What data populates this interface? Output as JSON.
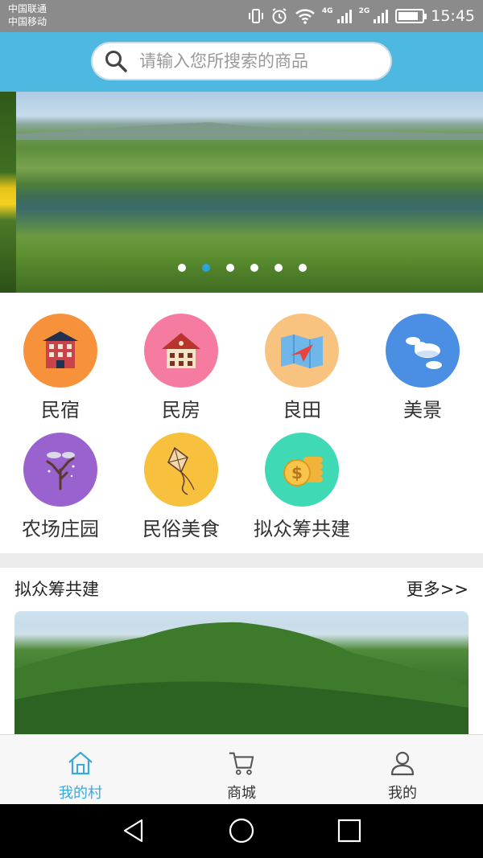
{
  "status_bar": {
    "carrier_1": "中国联通",
    "carrier_2": "中国移动",
    "net_1": "4G",
    "net_2": "2G",
    "time": "15:45",
    "battery_level": 0.85
  },
  "search": {
    "placeholder": "请输入您所搜索的商品"
  },
  "banner": {
    "dot_count": 6,
    "active_dot": 1
  },
  "categories": [
    {
      "label": "民宿",
      "icon": "hotel-building-icon",
      "color": "#f7923a"
    },
    {
      "label": "民房",
      "icon": "house-icon",
      "color": "#f57ca0"
    },
    {
      "label": "良田",
      "icon": "map-icon",
      "color": "#f8c27f"
    },
    {
      "label": "美景",
      "icon": "clouds-icon",
      "color": "#4a8fe4"
    },
    {
      "label": "农场庄园",
      "icon": "tree-icon",
      "color": "#9a62cf"
    },
    {
      "label": "民俗美食",
      "icon": "kite-icon",
      "color": "#f7c13e"
    },
    {
      "label": "拟众筹共建",
      "icon": "coins-icon",
      "color": "#3fd9b6"
    }
  ],
  "section": {
    "title": "拟众筹共建",
    "more": "更多>>"
  },
  "bottom_nav": {
    "items": [
      {
        "label": "我的村",
        "icon": "home-icon",
        "active": true
      },
      {
        "label": "商城",
        "icon": "cart-icon",
        "active": false
      },
      {
        "label": "我的",
        "icon": "user-icon",
        "active": false
      }
    ],
    "active_color": "#3aa9dc"
  },
  "system_nav": {
    "buttons": [
      "back-icon",
      "home-circle-icon",
      "recents-icon"
    ]
  }
}
